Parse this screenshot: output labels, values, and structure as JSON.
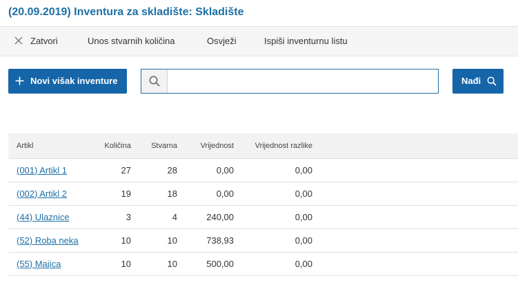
{
  "header": {
    "title": "(20.09.2019) Inventura za skladište: Skladište"
  },
  "toolbar": {
    "close_label": "Zatvori",
    "enter_actual_label": "Unos stvarnih količina",
    "refresh_label": "Osvježi",
    "print_label": "Ispiši inventurnu listu"
  },
  "actions": {
    "new_surplus_label": "Novi višak inventure",
    "search_placeholder": "",
    "search_value": "",
    "find_label": "Nađi"
  },
  "table": {
    "columns": [
      "Artikl",
      "Količina",
      "Stvarna",
      "Vrijednost",
      "Vrijednost razlike"
    ],
    "rows": [
      {
        "artikl": "(001) Artikl 1",
        "kolicina": "27",
        "stvarna": "28",
        "vrijednost": "0,00",
        "razlika": "0,00"
      },
      {
        "artikl": "(002) Artikl 2",
        "kolicina": "19",
        "stvarna": "18",
        "vrijednost": "0,00",
        "razlika": "0,00"
      },
      {
        "artikl": "(44) Ulaznice",
        "kolicina": "3",
        "stvarna": "4",
        "vrijednost": "240,00",
        "razlika": "0,00"
      },
      {
        "artikl": "(52) Roba neka",
        "kolicina": "10",
        "stvarna": "10",
        "vrijednost": "738,93",
        "razlika": "0,00"
      },
      {
        "artikl": "(55) Majica",
        "kolicina": "10",
        "stvarna": "10",
        "vrijednost": "500,00",
        "razlika": "0,00"
      }
    ]
  },
  "icons": {
    "close": "close-icon",
    "plus": "plus-icon",
    "search": "search-icon"
  },
  "colors": {
    "brand": "#1d6fa5",
    "button": "#1565a8"
  }
}
